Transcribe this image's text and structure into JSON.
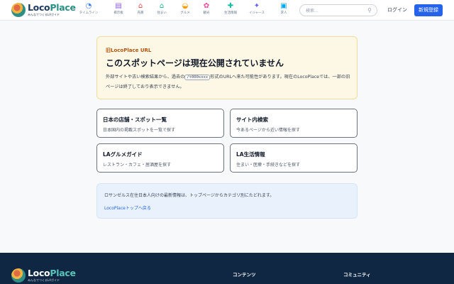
{
  "header": {
    "logo": {
      "word_a": "Loco",
      "word_b": "Place",
      "tagline": "みんなでつくるLAガイド"
    },
    "nav": [
      {
        "label": "タイムライン",
        "icon": "clock-icon",
        "glyph": "◔",
        "color": "#3b82f6"
      },
      {
        "label": "掲示板",
        "icon": "board-icon",
        "glyph": "▤",
        "color": "#8b5cf6"
      },
      {
        "label": "売買",
        "icon": "shop-icon",
        "glyph": "⌂",
        "color": "#ef4444"
      },
      {
        "label": "住まい",
        "icon": "home-icon",
        "glyph": "⌂",
        "color": "#10b981"
      },
      {
        "label": "グルメ",
        "icon": "food-icon",
        "glyph": "◒",
        "color": "#f59e0b"
      },
      {
        "label": "観光",
        "icon": "sightseeing-icon",
        "glyph": "✿",
        "color": "#ec4899"
      },
      {
        "label": "生活情報",
        "icon": "info-icon",
        "glyph": "✚",
        "color": "#14b8a6"
      },
      {
        "label": "イジャース",
        "icon": "sports-icon",
        "glyph": "✦",
        "color": "#6366f1"
      },
      {
        "label": "求人",
        "icon": "jobs-icon",
        "glyph": "▣",
        "color": "#0ea5e9"
      }
    ],
    "search": {
      "placeholder": "検索..."
    },
    "login": "ログイン",
    "register": "新規登録"
  },
  "notice": {
    "kicker": "旧LocoPlace URL",
    "title": "このスポットページは現在公開されていません",
    "body_before": "外部サイトや古い検索結果から、過去の",
    "code": "/t000xxxx",
    "body_after": "形式のURLへ来た可能性があります。現在のLocoPlaceでは、一部の旧ページは終了しており表示できません。"
  },
  "cards": [
    {
      "title": "日本の店舗・スポット一覧",
      "desc": "日本国内の掲載スポットを一覧で探す"
    },
    {
      "title": "サイト内検索",
      "desc": "今あるページから近い情報を探す"
    },
    {
      "title": "LAグルメガイド",
      "desc": "レストラン・カフェ・居酒屋を探す"
    },
    {
      "title": "LA生活情報",
      "desc": "住まい・医療・手続きなどを探す"
    }
  ],
  "info": {
    "text": "ロサンゼルス在住日本人向けの最新情報は、トップページからカテゴリ別にたどれます。",
    "link": "LocoPlaceトップへ戻る"
  },
  "footer": {
    "logo": {
      "word_a": "Loco",
      "word_b": "Place",
      "tagline": "みんなでつくるLAガイド"
    },
    "headings": [
      "コンテンツ",
      "コミュニティ"
    ]
  },
  "colors": {
    "accent": "#2563eb",
    "notice_bg": "#fdf8e6",
    "footer_bg": "#0f2742"
  }
}
